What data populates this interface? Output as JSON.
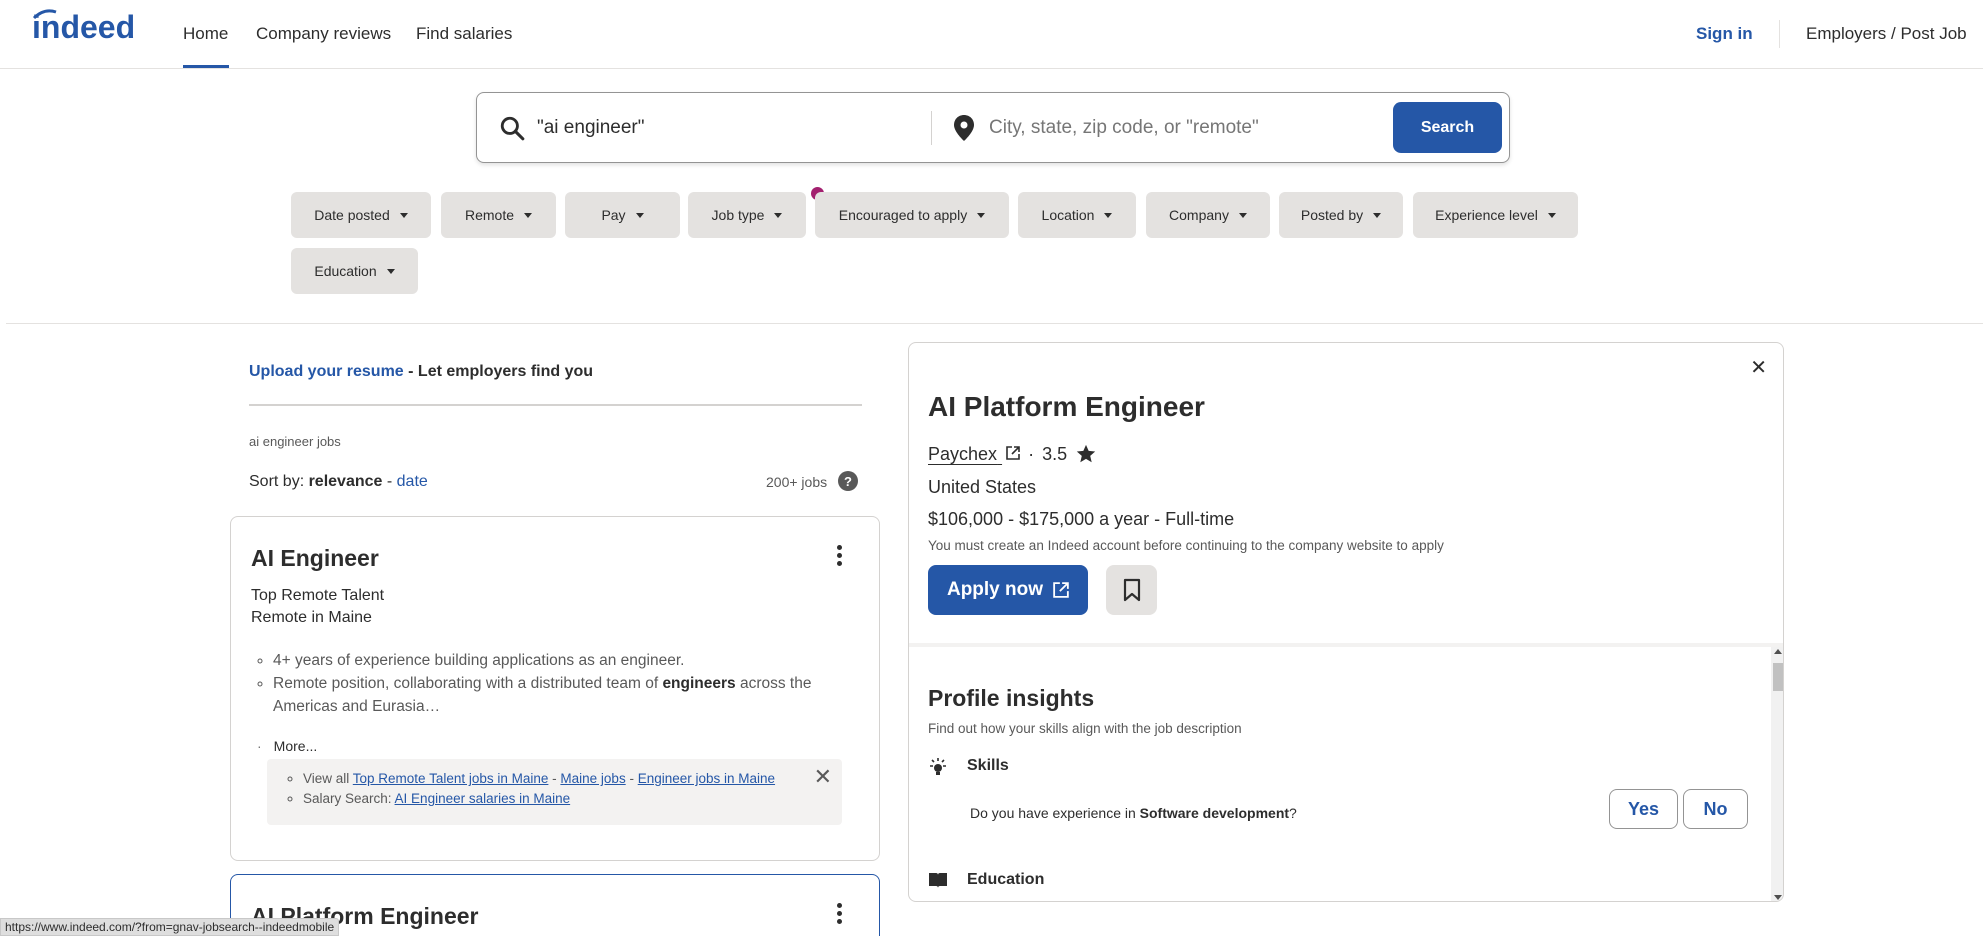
{
  "header": {
    "logo_text": "indeed",
    "nav": [
      "Home",
      "Company reviews",
      "Find salaries"
    ],
    "sign_in": "Sign in",
    "employers": "Employers / Post Job"
  },
  "search": {
    "what_value": "\"ai engineer\"",
    "where_placeholder": "City, state, zip code, or \"remote\"",
    "button": "Search"
  },
  "filters": [
    "Date posted",
    "Remote",
    "Pay",
    "Job type",
    "Encouraged to apply",
    "Location",
    "Company",
    "Posted by",
    "Experience level",
    "Education"
  ],
  "left": {
    "upload_link": "Upload your resume",
    "upload_rest": " - Let employers find you",
    "caption": "ai engineer jobs",
    "sort_label": "Sort by: ",
    "sort_relevance": "relevance",
    "sort_sep": " - ",
    "sort_date": "date",
    "job_count": "200+ jobs"
  },
  "cards": [
    {
      "title": "AI Engineer",
      "company": "Top Remote Talent",
      "location": "Remote in Maine",
      "bullet1": "4+ years of experience building applications as an engineer.",
      "bullet2_a": "Remote position, collaborating with a distributed team of ",
      "bullet2_b": "engineers",
      "bullet2_c": " across the Americas and Eurasia…",
      "more": "More...",
      "view_all": "View all ",
      "link1": "Top Remote Talent jobs in Maine",
      "sep": " - ",
      "link2": "Maine jobs",
      "link3": "Engineer jobs in Maine",
      "salary_search": "Salary Search: ",
      "link4": "AI Engineer salaries in Maine"
    },
    {
      "title": "AI Platform Engineer"
    }
  ],
  "detail": {
    "title": "AI Platform Engineer",
    "company": "Paychex",
    "dot": "·",
    "rating": "3.5",
    "location": "United States",
    "salary": "$106,000 - $175,000 a year  - Full-time",
    "note": "You must create an Indeed account before continuing to the company website to apply",
    "apply": "Apply now",
    "insights_title": "Profile insights",
    "insights_sub": "Find out how your skills align with the job description",
    "skills": "Skills",
    "question_a": "Do you have experience in ",
    "question_b": "Software development",
    "question_c": "?",
    "yes": "Yes",
    "no": "No",
    "education": "Education"
  },
  "status_url": "https://www.indeed.com/?from=gnav-jobsearch--indeedmobile",
  "colors": {
    "brand": "#2557a7",
    "chip": "#e4e2e0",
    "notif": "#a3206f"
  }
}
